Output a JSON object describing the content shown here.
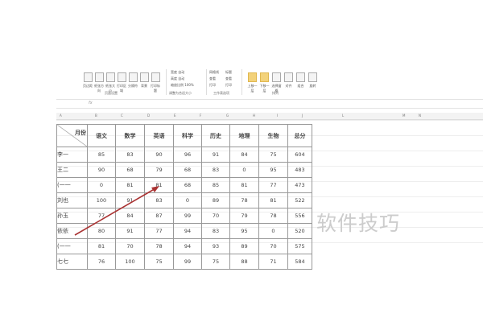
{
  "ribbon": {
    "buttons": [
      "页边距",
      "纸张方向",
      "纸张大小",
      "打印区域",
      "分隔符",
      "背景",
      "打印标题"
    ],
    "scale": [
      {
        "label": "宽度",
        "value": "自动"
      },
      {
        "label": "高度",
        "value": "自动"
      },
      {
        "label": "缩放比例",
        "value": "100%"
      }
    ],
    "sheet_options": [
      "网格线",
      "标题",
      "查看",
      "查看",
      "打印",
      "打印"
    ],
    "arrange": [
      "上移一层",
      "下移一层",
      "选择窗格",
      "对齐",
      "组合",
      "旋转"
    ],
    "groups": [
      "页面设置",
      "调整为合适大小",
      "工作表选项",
      "排列"
    ]
  },
  "formula_bar": {
    "fx": "fx"
  },
  "columns": [
    "A",
    "B",
    "C",
    "D",
    "E",
    "F",
    "G",
    "H",
    "I",
    "J",
    "L",
    "M",
    "N"
  ],
  "table": {
    "corner": "月份",
    "headers": [
      "语文",
      "数学",
      "英语",
      "科学",
      "历史",
      "地理",
      "生物",
      "总分"
    ],
    "rows": [
      {
        "name": "李一",
        "v": [
          "85",
          "83",
          "90",
          "96",
          "91",
          "84",
          "75",
          "604"
        ]
      },
      {
        "name": "王二",
        "v": [
          "90",
          "68",
          "79",
          "68",
          "83",
          "0",
          "95",
          "483"
        ]
      },
      {
        "name": "(一一",
        "v": [
          "0",
          "81",
          "81",
          "68",
          "85",
          "81",
          "77",
          "473"
        ]
      },
      {
        "name": "刘也",
        "v": [
          "100",
          "91",
          "83",
          "0",
          "89",
          "78",
          "81",
          "522"
        ]
      },
      {
        "name": "孙玉",
        "v": [
          "77",
          "84",
          "87",
          "99",
          "70",
          "79",
          "78",
          "556"
        ]
      },
      {
        "name": "依依",
        "v": [
          "80",
          "91",
          "77",
          "94",
          "83",
          "95",
          "0",
          "520"
        ]
      },
      {
        "name": "(一一",
        "v": [
          "81",
          "70",
          "78",
          "94",
          "93",
          "89",
          "70",
          "575"
        ]
      },
      {
        "name": "七七",
        "v": [
          "76",
          "100",
          "75",
          "99",
          "75",
          "88",
          "71",
          "584"
        ]
      }
    ]
  },
  "watermark": "软件技巧"
}
